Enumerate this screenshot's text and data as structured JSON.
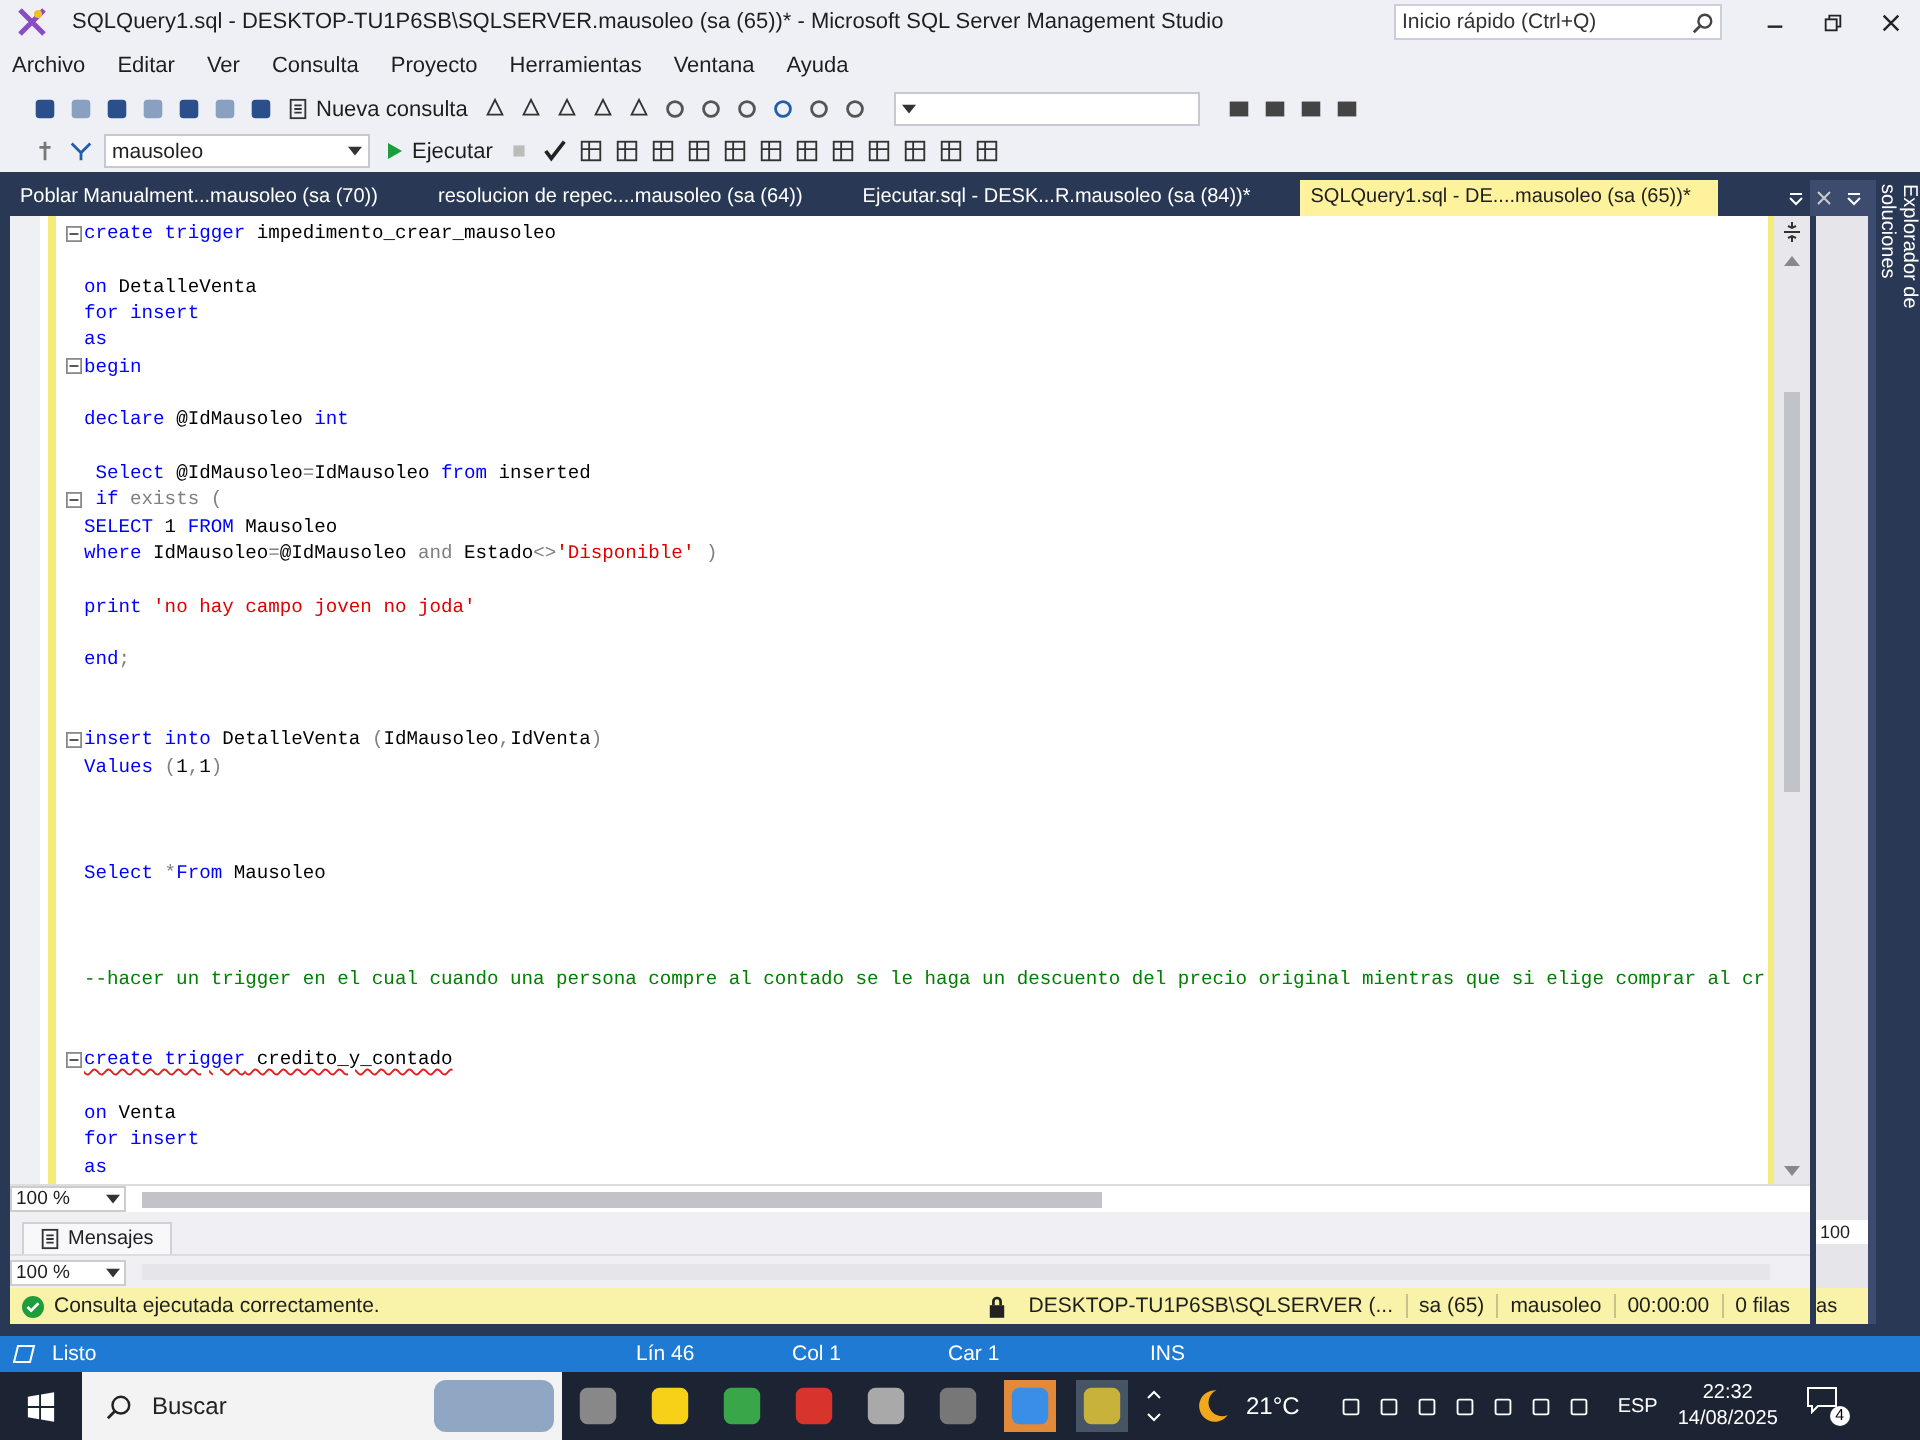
{
  "window": {
    "title": "SQLQuery1.sql - DESKTOP-TU1P6SB\\SQLSERVER.mausoleo (sa (65))* - Microsoft SQL Server Management Studio",
    "quick_launch": {
      "placeholder": "Inicio rápido (Ctrl+Q)"
    }
  },
  "menu": [
    "Archivo",
    "Editar",
    "Ver",
    "Consulta",
    "Proyecto",
    "Herramientas",
    "Ventana",
    "Ayuda"
  ],
  "toolbar": {
    "new_query": "Nueva consulta",
    "database": "mausoleo",
    "execute": "Ejecutar"
  },
  "tabs": [
    {
      "label": "Poblar Manualment...mausoleo (sa (70))",
      "selected": false
    },
    {
      "label": "resolucion de repec....mausoleo (sa (64))",
      "selected": false
    },
    {
      "label": "Ejecutar.sql - DESK...R.mausoleo (sa (84))*",
      "selected": false
    },
    {
      "label": "SQLQuery1.sql - DE....mausoleo (sa (65))*",
      "selected": true
    }
  ],
  "side_panel": {
    "title": "Explorador de soluciones"
  },
  "editor": {
    "lines": [
      {
        "kind": "code",
        "fold": true,
        "tokens": [
          {
            "kind": "keyword",
            "text": "create trigger"
          },
          {
            "kind": "plain",
            "text": " impedimento_crear_mausoleo"
          }
        ]
      },
      {
        "kind": "blank"
      },
      {
        "kind": "code",
        "fold": false,
        "tokens": [
          {
            "kind": "keyword",
            "text": "on"
          },
          {
            "kind": "plain",
            "text": " DetalleVenta"
          }
        ]
      },
      {
        "kind": "code",
        "fold": false,
        "tokens": [
          {
            "kind": "keyword",
            "text": "for insert"
          }
        ]
      },
      {
        "kind": "code",
        "fold": false,
        "tokens": [
          {
            "kind": "keyword",
            "text": "as"
          }
        ]
      },
      {
        "kind": "code",
        "fold": true,
        "tokens": [
          {
            "kind": "keyword",
            "text": "begin"
          }
        ]
      },
      {
        "kind": "blank"
      },
      {
        "kind": "code",
        "fold": false,
        "tokens": [
          {
            "kind": "keyword",
            "text": "declare"
          },
          {
            "kind": "plain",
            "text": " @IdMausoleo "
          },
          {
            "kind": "keyword",
            "text": "int"
          }
        ]
      },
      {
        "kind": "blank"
      },
      {
        "kind": "code",
        "fold": false,
        "tokens": [
          {
            "kind": "keyword",
            "text": " Select"
          },
          {
            "kind": "plain",
            "text": " @IdMausoleo"
          },
          {
            "kind": "operator",
            "text": "="
          },
          {
            "kind": "plain",
            "text": "IdMausoleo "
          },
          {
            "kind": "keyword",
            "text": "from"
          },
          {
            "kind": "plain",
            "text": " inserted"
          }
        ]
      },
      {
        "kind": "code",
        "fold": true,
        "tokens": [
          {
            "kind": "keyword",
            "text": " if"
          },
          {
            "kind": "operator",
            "text": " exists ("
          }
        ]
      },
      {
        "kind": "code",
        "fold": false,
        "tokens": [
          {
            "kind": "keyword",
            "text": "SELECT"
          },
          {
            "kind": "plain",
            "text": " 1 "
          },
          {
            "kind": "keyword",
            "text": "FROM"
          },
          {
            "kind": "plain",
            "text": " Mausoleo"
          }
        ]
      },
      {
        "kind": "code",
        "fold": false,
        "tokens": [
          {
            "kind": "keyword",
            "text": "where"
          },
          {
            "kind": "plain",
            "text": " IdMausoleo"
          },
          {
            "kind": "operator",
            "text": "="
          },
          {
            "kind": "plain",
            "text": "@IdMausoleo "
          },
          {
            "kind": "operator",
            "text": "and"
          },
          {
            "kind": "plain",
            "text": " Estado"
          },
          {
            "kind": "operator",
            "text": "<>"
          },
          {
            "kind": "string",
            "text": "'Disponible'"
          },
          {
            "kind": "operator",
            "text": " )"
          }
        ]
      },
      {
        "kind": "blank"
      },
      {
        "kind": "code",
        "fold": false,
        "tokens": [
          {
            "kind": "keyword",
            "text": "print"
          },
          {
            "kind": "string",
            "text": " 'no hay campo joven no joda'"
          }
        ]
      },
      {
        "kind": "blank"
      },
      {
        "kind": "code",
        "fold": false,
        "tokens": [
          {
            "kind": "keyword",
            "text": "end"
          },
          {
            "kind": "operator",
            "text": ";"
          }
        ]
      },
      {
        "kind": "blank"
      },
      {
        "kind": "blank"
      },
      {
        "kind": "code",
        "fold": true,
        "tokens": [
          {
            "kind": "keyword",
            "text": "insert into"
          },
          {
            "kind": "plain",
            "text": " DetalleVenta "
          },
          {
            "kind": "operator",
            "text": "("
          },
          {
            "kind": "plain",
            "text": "IdMausoleo"
          },
          {
            "kind": "operator",
            "text": ","
          },
          {
            "kind": "plain",
            "text": "IdVenta"
          },
          {
            "kind": "operator",
            "text": ")"
          }
        ]
      },
      {
        "kind": "code",
        "fold": false,
        "tokens": [
          {
            "kind": "keyword",
            "text": "Values"
          },
          {
            "kind": "operator",
            "text": " ("
          },
          {
            "kind": "plain",
            "text": "1"
          },
          {
            "kind": "operator",
            "text": ","
          },
          {
            "kind": "plain",
            "text": "1"
          },
          {
            "kind": "operator",
            "text": ")"
          }
        ]
      },
      {
        "kind": "blank"
      },
      {
        "kind": "blank"
      },
      {
        "kind": "blank"
      },
      {
        "kind": "code",
        "fold": false,
        "tokens": [
          {
            "kind": "keyword",
            "text": "Select"
          },
          {
            "kind": "operator",
            "text": " *"
          },
          {
            "kind": "keyword",
            "text": "From"
          },
          {
            "kind": "plain",
            "text": " Mausoleo"
          }
        ]
      },
      {
        "kind": "blank"
      },
      {
        "kind": "blank"
      },
      {
        "kind": "blank"
      },
      {
        "kind": "code",
        "fold": false,
        "tokens": [
          {
            "kind": "comment",
            "text": "--hacer un trigger en el cual cuando una persona compre al contado se le haga un descuento del precio original mientras que si elige comprar al cr"
          }
        ]
      },
      {
        "kind": "blank"
      },
      {
        "kind": "blank"
      },
      {
        "kind": "code",
        "fold": true,
        "squiggle": true,
        "tokens": [
          {
            "kind": "keyword",
            "text": "create trigger"
          },
          {
            "kind": "plain",
            "text": " credito_y_contado"
          }
        ]
      },
      {
        "kind": "blank"
      },
      {
        "kind": "code",
        "fold": false,
        "tokens": [
          {
            "kind": "keyword",
            "text": "on"
          },
          {
            "kind": "plain",
            "text": " Venta"
          }
        ]
      },
      {
        "kind": "code",
        "fold": false,
        "tokens": [
          {
            "kind": "keyword",
            "text": "for insert"
          }
        ]
      },
      {
        "kind": "code",
        "fold": false,
        "tokens": [
          {
            "kind": "keyword",
            "text": "as"
          }
        ]
      }
    ],
    "zoom": "100 %"
  },
  "results": {
    "tab": "Mensajes",
    "zoom": "100 %",
    "side_zoom": "100",
    "side_status": "as"
  },
  "query_status": {
    "message": "Consulta ejecutada correctamente.",
    "server": "DESKTOP-TU1P6SB\\SQLSERVER (...",
    "user": "sa (65)",
    "database": "mausoleo",
    "time": "00:00:00",
    "rows": "0 filas"
  },
  "status_bar": {
    "state": "Listo",
    "line": "Lín 46",
    "column": "Col 1",
    "char": "Car 1",
    "mode": "INS"
  },
  "taskbar": {
    "search": "Buscar",
    "weather": "21°C",
    "language": "ESP",
    "time": "22:32",
    "date": "14/08/2025",
    "notifications": "4"
  }
}
